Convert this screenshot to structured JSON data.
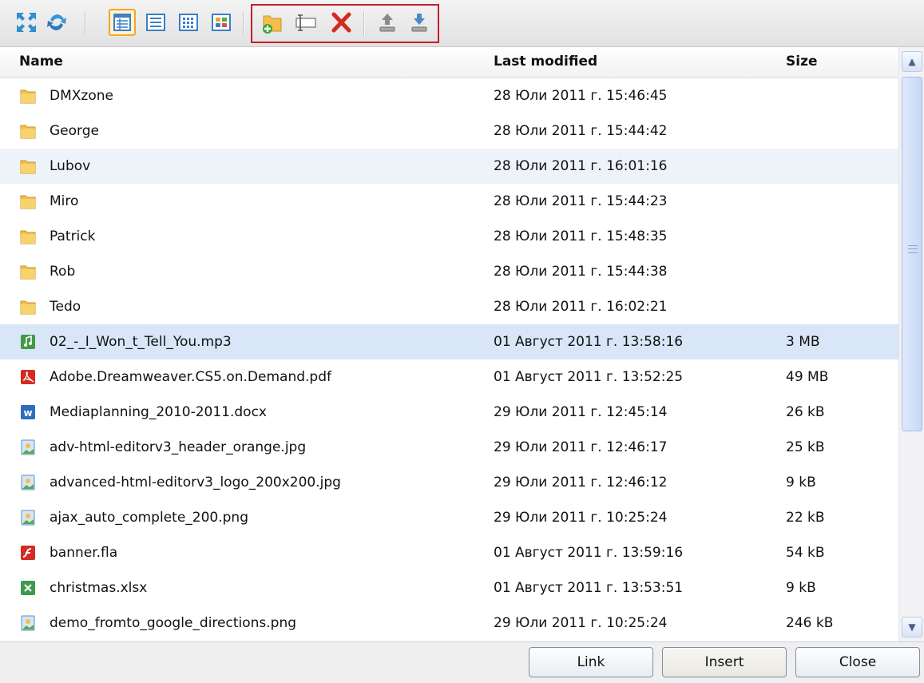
{
  "toolbar": {
    "groups": [
      {
        "icons": [
          "fullscreen-icon",
          "refresh-icon"
        ]
      },
      {
        "icons": [
          "details-view-icon",
          "list-view-icon",
          "small-icons-view-icon",
          "thumbnails-view-icon"
        ],
        "active": "details-view-icon"
      },
      {
        "icons": [
          "new-folder-icon",
          "rename-icon",
          "delete-icon",
          "upload-icon",
          "download-icon"
        ],
        "highlighted": true
      }
    ],
    "highlight_color": "#c0202a"
  },
  "columns": {
    "name": "Name",
    "modified": "Last modified",
    "size": "Size"
  },
  "rows": [
    {
      "name": "DMXzone",
      "modified": "28 Юли 2011 г. 15:46:45",
      "size": "",
      "type": "folder"
    },
    {
      "name": "George",
      "modified": "28 Юли 2011 г. 15:44:42",
      "size": "",
      "type": "folder"
    },
    {
      "name": "Lubov",
      "modified": "28 Юли 2011 г. 16:01:16",
      "size": "",
      "type": "folder",
      "state": "hover"
    },
    {
      "name": "Miro",
      "modified": "28 Юли 2011 г. 15:44:23",
      "size": "",
      "type": "folder"
    },
    {
      "name": "Patrick",
      "modified": "28 Юли 2011 г. 15:48:35",
      "size": "",
      "type": "folder"
    },
    {
      "name": "Rob",
      "modified": "28 Юли 2011 г. 15:44:38",
      "size": "",
      "type": "folder"
    },
    {
      "name": "Tedo",
      "modified": "28 Юли 2011 г. 16:02:21",
      "size": "",
      "type": "folder"
    },
    {
      "name": "02_-_I_Won_t_Tell_You.mp3",
      "modified": "01 Август 2011 г. 13:58:16",
      "size": "3 MB",
      "type": "audio",
      "state": "selected"
    },
    {
      "name": "Adobe.Dreamweaver.CS5.on.Demand.pdf",
      "modified": "01 Август 2011 г. 13:52:25",
      "size": "49 MB",
      "type": "pdf"
    },
    {
      "name": "Mediaplanning_2010-2011.docx",
      "modified": "29 Юли 2011 г. 12:45:14",
      "size": "26 kB",
      "type": "word"
    },
    {
      "name": "adv-html-editorv3_header_orange.jpg",
      "modified": "29 Юли 2011 г. 12:46:17",
      "size": "25 kB",
      "type": "image"
    },
    {
      "name": "advanced-html-editorv3_logo_200x200.jpg",
      "modified": "29 Юли 2011 г. 12:46:12",
      "size": "9 kB",
      "type": "image"
    },
    {
      "name": "ajax_auto_complete_200.png",
      "modified": "29 Юли 2011 г. 10:25:24",
      "size": "22 kB",
      "type": "image"
    },
    {
      "name": "banner.fla",
      "modified": "01 Август 2011 г. 13:59:16",
      "size": "54 kB",
      "type": "flash"
    },
    {
      "name": "christmas.xlsx",
      "modified": "01 Август 2011 г. 13:53:51",
      "size": "9 kB",
      "type": "excel"
    },
    {
      "name": "demo_fromto_google_directions.png",
      "modified": "29 Юли 2011 г. 10:25:24",
      "size": "246 kB",
      "type": "image"
    }
  ],
  "footer": {
    "link": "Link",
    "insert": "Insert",
    "close": "Close"
  },
  "colors": {
    "selected_row": "#d8e6f7",
    "hover_row": "#eef3fa",
    "folder": "#f2c04a"
  }
}
